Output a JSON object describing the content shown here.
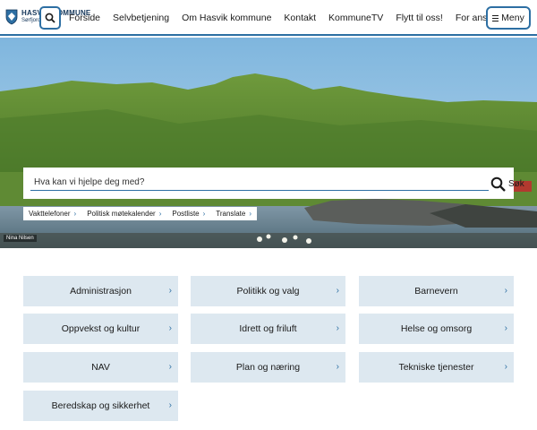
{
  "brand": {
    "name_line1": "HASVIK KOMMUNE",
    "name_line2": "Sørfjorden lokalt",
    "logo_icon": "shield-icon"
  },
  "header": {
    "search_icon": "search-icon",
    "nav": [
      "Forside",
      "Selvbetjening",
      "Om Hasvik kommune",
      "Kontakt",
      "KommuneTV",
      "Flytt til oss!",
      "For ansatte"
    ],
    "menu_label": "Meny",
    "menu_icon": "hamburger-icon",
    "accent_color": "#2d6fa3"
  },
  "hero": {
    "search_placeholder": "Hva kan vi hjelpe deg med?",
    "search_button_label": "Søk",
    "quicklinks": [
      "Vakttelefoner",
      "Politisk møtekalender",
      "Postliste",
      "Translate"
    ],
    "photo_credit": "Nina Nilsen"
  },
  "services": [
    "Administrasjon",
    "Politikk og valg",
    "Barnevern",
    "Oppvekst og kultur",
    "Idrett og friluft",
    "Helse og omsorg",
    "NAV",
    "Plan og næring",
    "Tekniske tjenester",
    "Beredskap og sikkerhet"
  ],
  "colors": {
    "card_bg": "#dde8f0",
    "chevron": "#2d6fa3"
  }
}
